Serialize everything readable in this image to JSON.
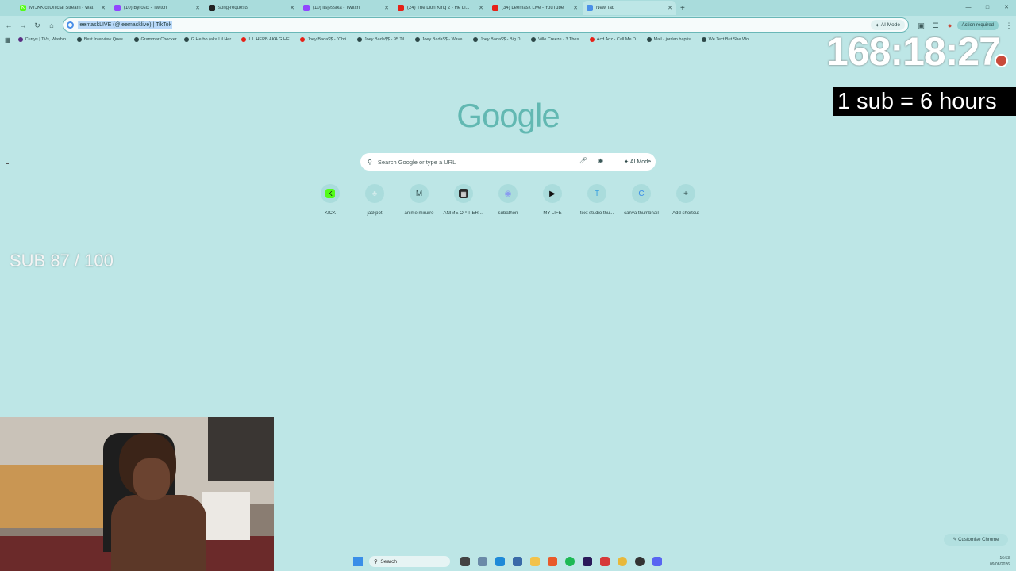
{
  "tabs": [
    {
      "title": "MrJKKickOfficial Stream - Wat",
      "color": "#53fc18",
      "glyph": "K"
    },
    {
      "title": "(10) Byrosix - Twitch",
      "color": "#9146ff",
      "glyph": ""
    },
    {
      "title": "song-requests",
      "color": "#222222",
      "glyph": ""
    },
    {
      "title": "(10) itsjessika - Twitch",
      "color": "#9146ff",
      "glyph": ""
    },
    {
      "title": "(24) The Lion King 2 - He Li...",
      "color": "#e62117",
      "glyph": ""
    },
    {
      "title": "(34) Leemask Live - YouTube",
      "color": "#e62117",
      "glyph": ""
    },
    {
      "title": "New Tab",
      "color": "#4a8fe8",
      "glyph": ""
    }
  ],
  "omnibox": {
    "value": "leemaskLIVE (@leemasklive) | TikTok",
    "ai_mode": "AI Mode",
    "action_required": "Action required"
  },
  "bookmarks": [
    {
      "label": "Currys | TVs, Washin...",
      "color": "#5a2d82"
    },
    {
      "label": "Best Interview Ques...",
      "color": "#2d4848"
    },
    {
      "label": "Grammar Checker",
      "color": "#2d4848"
    },
    {
      "label": "G Herbo (aka Lil Her...",
      "color": "#2d4848"
    },
    {
      "label": "LIL HERB AKA G HE...",
      "color": "#e62117"
    },
    {
      "label": "Joey Bada$$ - \"Chri...",
      "color": "#e62117"
    },
    {
      "label": "Joey Bada$$ - 95 Til...",
      "color": "#2d4848"
    },
    {
      "label": "Joey Bada$$ - Wave...",
      "color": "#2d4848"
    },
    {
      "label": "Joey Bada$$ - Big D...",
      "color": "#2d4848"
    },
    {
      "label": "Ville Creeze - 3 Thes...",
      "color": "#2d4848"
    },
    {
      "label": "Acd Adz - Call Me D...",
      "color": "#e62117"
    },
    {
      "label": "Mail - jordan baptis...",
      "color": "#2d4848"
    },
    {
      "label": "We Text But She Wo...",
      "color": "#2d4848"
    }
  ],
  "google": {
    "logo": "Google",
    "search_placeholder": "Search Google or type a URL",
    "ai_mode": "AI Mode"
  },
  "shortcuts": [
    {
      "label": "KICK",
      "icon": "kick-icon",
      "glyph": "K",
      "color": "#53fc18"
    },
    {
      "label": "jackpot",
      "icon": "jackpot-icon",
      "glyph": "♣",
      "color": "#d3ecec"
    },
    {
      "label": "anime mirurro",
      "icon": "m-icon",
      "glyph": "M",
      "color": "#3b5858"
    },
    {
      "label": "ANIME OP TIER ...",
      "icon": "tier-icon",
      "glyph": "▦",
      "color": "#2a2a2a"
    },
    {
      "label": "subathon",
      "icon": "subathon-icon",
      "glyph": "◉",
      "color": "#8a9cf0"
    },
    {
      "label": "MY LIFE",
      "icon": "play-icon",
      "glyph": "▶",
      "color": "#111111"
    },
    {
      "label": "text studio thu...",
      "icon": "text-studio-icon",
      "glyph": "T",
      "color": "#3aa0e0"
    },
    {
      "label": "canva thumbnail",
      "icon": "canva-icon",
      "glyph": "C",
      "color": "#3a8ee8"
    },
    {
      "label": "Add shortcut",
      "icon": "plus-icon",
      "glyph": "+",
      "color": "#3b5858"
    }
  ],
  "overlay": {
    "timer": "168:18:27",
    "sub_rate": "1 sub = 6 hours",
    "sub_goal": "SUB 87 / 100"
  },
  "customise_chrome": "Customise Chrome",
  "taskbar": {
    "search_label": "Search",
    "time": "16:53",
    "date": "09/08/2026"
  }
}
